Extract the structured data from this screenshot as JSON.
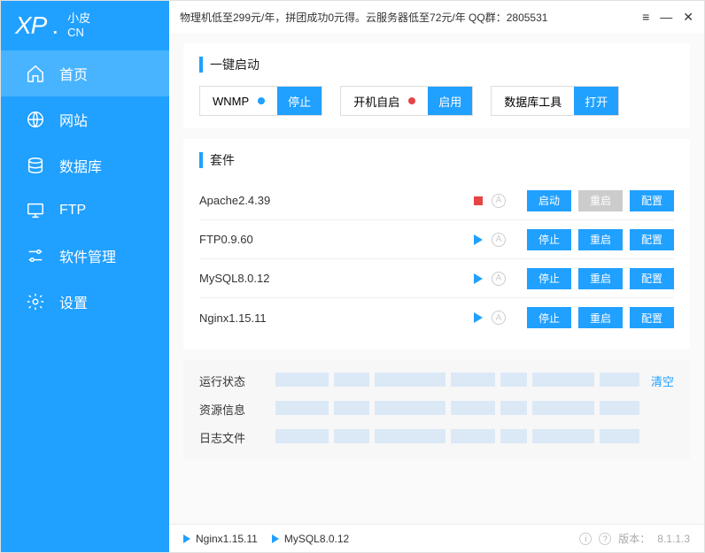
{
  "brand": {
    "xp": "XP",
    "dot": ".",
    "cn_line1": "小皮",
    "cn_line2": "CN"
  },
  "titlebar": {
    "promo": "物理机低至299元/年，拼团成功0元得。云服务器低至72元/年   QQ群：2805531"
  },
  "nav": [
    {
      "label": "首页",
      "icon": "home",
      "active": true
    },
    {
      "label": "网站",
      "icon": "globe",
      "active": false
    },
    {
      "label": "数据库",
      "icon": "database",
      "active": false
    },
    {
      "label": "FTP",
      "icon": "monitor",
      "active": false
    },
    {
      "label": "软件管理",
      "icon": "sliders",
      "active": false
    },
    {
      "label": "设置",
      "icon": "gear",
      "active": false
    }
  ],
  "quick": {
    "title": "一键启动",
    "items": [
      {
        "label": "WNMP",
        "dot": "blue",
        "button": "停止"
      },
      {
        "label": "开机自启",
        "dot": "red",
        "button": "启用"
      },
      {
        "label": "数据库工具",
        "dot": "",
        "button": "打开"
      }
    ]
  },
  "components": {
    "title": "套件",
    "items": [
      {
        "name": "Apache2.4.39",
        "running": false,
        "btn1": "启动",
        "btn1_gray": false,
        "btn2": "重启",
        "btn2_gray": true,
        "btn3": "配置"
      },
      {
        "name": "FTP0.9.60",
        "running": true,
        "btn1": "停止",
        "btn1_gray": false,
        "btn2": "重启",
        "btn2_gray": false,
        "btn3": "配置"
      },
      {
        "name": "MySQL8.0.12",
        "running": true,
        "btn1": "停止",
        "btn1_gray": false,
        "btn2": "重启",
        "btn2_gray": false,
        "btn3": "配置"
      },
      {
        "name": "Nginx1.15.11",
        "running": true,
        "btn1": "停止",
        "btn1_gray": false,
        "btn2": "重启",
        "btn2_gray": false,
        "btn3": "配置"
      }
    ]
  },
  "status": {
    "clear": "清空",
    "rows": [
      {
        "label": "运行状态"
      },
      {
        "label": "资源信息"
      },
      {
        "label": "日志文件"
      }
    ]
  },
  "footer": {
    "running": [
      "Nginx1.15.11",
      "MySQL8.0.12"
    ],
    "version_label": "版本：",
    "version": "8.1.1.3"
  }
}
